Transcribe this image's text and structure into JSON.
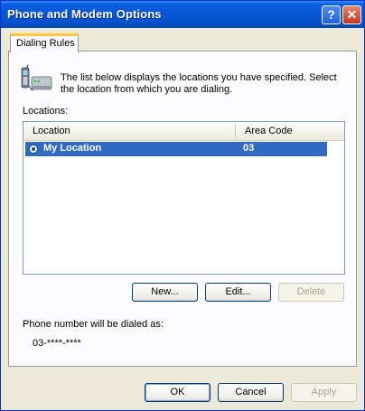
{
  "window": {
    "title": "Phone and Modem Options"
  },
  "titlebar": {
    "help_label": "?",
    "close_label": "✕"
  },
  "tabs": [
    {
      "label": "Dialing Rules"
    }
  ],
  "intro": {
    "text": "The list below displays the locations you have specified. Select the location from which you are dialing."
  },
  "locations": {
    "label": "Locations:",
    "columns": [
      "Location",
      "Area Code"
    ],
    "rows": [
      {
        "name": "My Location",
        "area_code": "03",
        "selected": true
      }
    ]
  },
  "location_buttons": {
    "new": "New...",
    "edit": "Edit...",
    "delete": "Delete"
  },
  "dialed_as": {
    "label": "Phone number will be dialed as:",
    "value": "03-****-****"
  },
  "dialog_buttons": {
    "ok": "OK",
    "cancel": "Cancel",
    "apply": "Apply"
  },
  "colors": {
    "selection": "#316ac5",
    "titlebar": "#0658d6",
    "tab_highlight": "#ffc83c"
  }
}
